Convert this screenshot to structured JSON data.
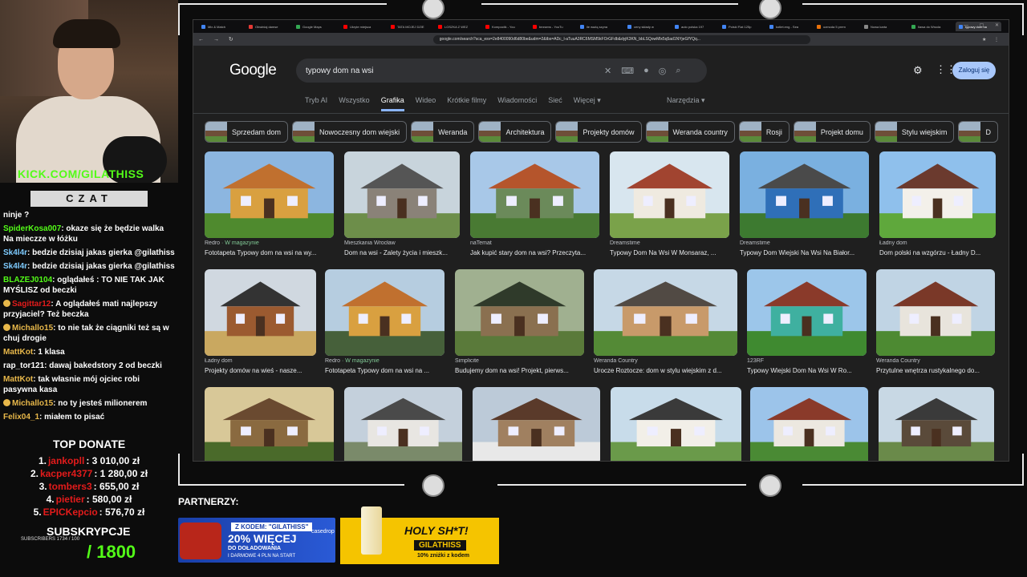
{
  "stream": {
    "kick_handle": "KICK.COM/GILATHISS",
    "chat_title": "CZAT",
    "chat": [
      {
        "user": "",
        "text": "ninje ?",
        "color": "#ffffff",
        "badge": false
      },
      {
        "user": "SpiderKosa007",
        "text": "okaze się że będzie walka Na mieczze w łóżku",
        "color": "#53fc18",
        "badge": false
      },
      {
        "user": "Sk4l4r",
        "text": "bedzie dzisiaj jakas gierka @gilathiss",
        "color": "#7ecbff",
        "badge": false
      },
      {
        "user": "Sk4l4r",
        "text": "bedzie dzisiaj jakas gierka @gilathiss",
        "color": "#7ecbff",
        "badge": false
      },
      {
        "user": "BLAZEJ0104",
        "text": "oglądałeś : TO NIE TAK JAK MYŚLISZ od beczki",
        "color": "#53fc18",
        "badge": false
      },
      {
        "user": "Sagittar12",
        "text": "A oglądałeś mati najlepszy przyjaciel? Też beczka",
        "color": "#e31b1b",
        "badge": true
      },
      {
        "user": "Michallo15",
        "text": "to nie tak że ciągniki też są w chuj drogie",
        "color": "#e8b84a",
        "badge": true
      },
      {
        "user": "MattKot",
        "text": "1 klasa",
        "color": "#e8b84a",
        "badge": false
      },
      {
        "user": "rap_tor121",
        "text": "dawaj bakedstory 2 od beczki",
        "color": "#ffffff",
        "badge": false
      },
      {
        "user": "MattKot",
        "text": "tak własnie mój ojciec robi pasywna kasa",
        "color": "#e8b84a",
        "badge": false
      },
      {
        "user": "Michallo15",
        "text": "no ty jesteś milionerem",
        "color": "#e8b84a",
        "badge": true
      },
      {
        "user": "Felix04_1",
        "text": "miałem to pisać",
        "color": "#e8b84a",
        "badge": false
      }
    ],
    "top_donate_title": "TOP DONATE",
    "donates": [
      {
        "rank": "1.",
        "name": "jankopll",
        "amount": ": 3 010,00 zł"
      },
      {
        "rank": "2.",
        "name": "kacper4377",
        "amount": ": 1 280,00 zł"
      },
      {
        "rank": "3.",
        "name": "tombers3",
        "amount": ": 655,00 zł"
      },
      {
        "rank": "4.",
        "name": "pietier",
        "amount": ": 580,00 zł"
      },
      {
        "rank": "5.",
        "name": "EPICKepcio",
        "amount": ": 576,70 zł"
      }
    ],
    "subs_title": "SUBSKRYPCJE",
    "subs_small": "SUBSCRIBERS 1734 / 100",
    "subs_goal": "/ 1800",
    "partners_title": "PARTNERZY:",
    "banner1": {
      "code": "Z KODEM: \"GILATHISS\"",
      "percent": "20% WIĘCEJ",
      "line1": "DO DOŁADOWANIA",
      "line2": "I DARMOWE 4 PLN NA START",
      "brand": "casedrop"
    },
    "banner2": {
      "title": "HOLY SH*T!",
      "code": "GILATHISS",
      "discount": "10% zniżki z kodem"
    }
  },
  "browser": {
    "tabs": [
      "Mix & Match",
      "Obwiniaj damse",
      "Google Maps",
      "Ukryte miejsca",
      "TATA MOJEJ DZIE",
      "LOSZKA Z WEZ",
      "Kompociik - You",
      "bezsens - YouTu",
      "ile ważą szyna",
      "ceny składy w ",
      "auto polska 197",
      "Polski Fiat 125p",
      "kotlet.eng - Sea",
      "ozmoda 5 prem",
      "Nowa karta",
      "Ilawa do Wrocła",
      "typowy dom na"
    ],
    "active_tab": 16,
    "url": "google.com/search?sca_esv=2e8400090d6d80be&udm=2&tbs=ADc_l-aTuuA3RC6MSM5kFOrGFdb&dyjK3KN_bbLSQowMlx5q5ad1NYjeGfYQq...",
    "search_query": "typowy dom na wsi",
    "logo": "Google",
    "login_label": "Zaloguj się",
    "nav": [
      "Tryb AI",
      "Wszystko",
      "Grafika",
      "Wideo",
      "Krótkie filmy",
      "Wiadomości",
      "Sieć",
      "Więcej ▾"
    ],
    "nav_active": 2,
    "tools_label": "Narzędzia ▾",
    "chips": [
      "Sprzedam dom",
      "Nowoczesny dom wiejski",
      "Weranda",
      "Architektura",
      "Projekty domów",
      "Weranda country",
      "Rosji",
      "Projekt domu",
      "Stylu wiejskim",
      "D"
    ],
    "results": [
      [
        {
          "source": "Redro",
          "mag": "· W magazynie",
          "caption": "Fototapeta Typowy dom na wsi na wy..."
        },
        {
          "source": "Mieszkania Wrocław",
          "mag": "",
          "caption": "Dom na wsi - Zalety życia i mieszk..."
        },
        {
          "source": "naTemat",
          "mag": "",
          "caption": "Jak kupić stary dom na wsi? Przeczyta..."
        },
        {
          "source": "Dreamstime",
          "mag": "",
          "caption": "Typowy Dom Na Wsi W Monsaraz, ..."
        },
        {
          "source": "Dreamstime",
          "mag": "",
          "caption": "Typowy Dom Wiejski Na Wsi Na Białor..."
        },
        {
          "source": "Ładny dom",
          "mag": "",
          "caption": "Dom polski na wzgórzu - Ładny D..."
        }
      ],
      [
        {
          "source": "Ładny dom",
          "mag": "",
          "caption": "Projekty domów na wieś - nasze..."
        },
        {
          "source": "Redro",
          "mag": "· W magazynie",
          "caption": "Fototapeta Typowy dom na wsi na ..."
        },
        {
          "source": "Simplicite",
          "mag": "",
          "caption": "Budujemy dom na wsi! Projekt, pierws..."
        },
        {
          "source": "Weranda Country",
          "mag": "",
          "caption": "Urocze Roztocze: dom w stylu wiejskim z d..."
        },
        {
          "source": "123RF",
          "mag": "",
          "caption": "Typowy Wiejski Dom Na Wsi W Ro..."
        },
        {
          "source": "Weranda Country",
          "mag": "",
          "caption": "Przytulne wnętrza rustykalnego do..."
        }
      ],
      [
        {
          "source": "",
          "mag": "",
          "caption": ""
        },
        {
          "source": "",
          "mag": "",
          "caption": ""
        },
        {
          "source": "",
          "mag": "",
          "caption": ""
        },
        {
          "source": "",
          "mag": "",
          "caption": ""
        },
        {
          "source": "",
          "mag": "",
          "caption": ""
        },
        {
          "source": "",
          "mag": "",
          "caption": ""
        }
      ]
    ],
    "colors": {
      "accent": "#8ab4f8",
      "login_bg": "#a8c7fa",
      "page_bg": "#1f1f1f",
      "kick_green": "#53fc18",
      "donate_red": "#e31b1b"
    }
  }
}
